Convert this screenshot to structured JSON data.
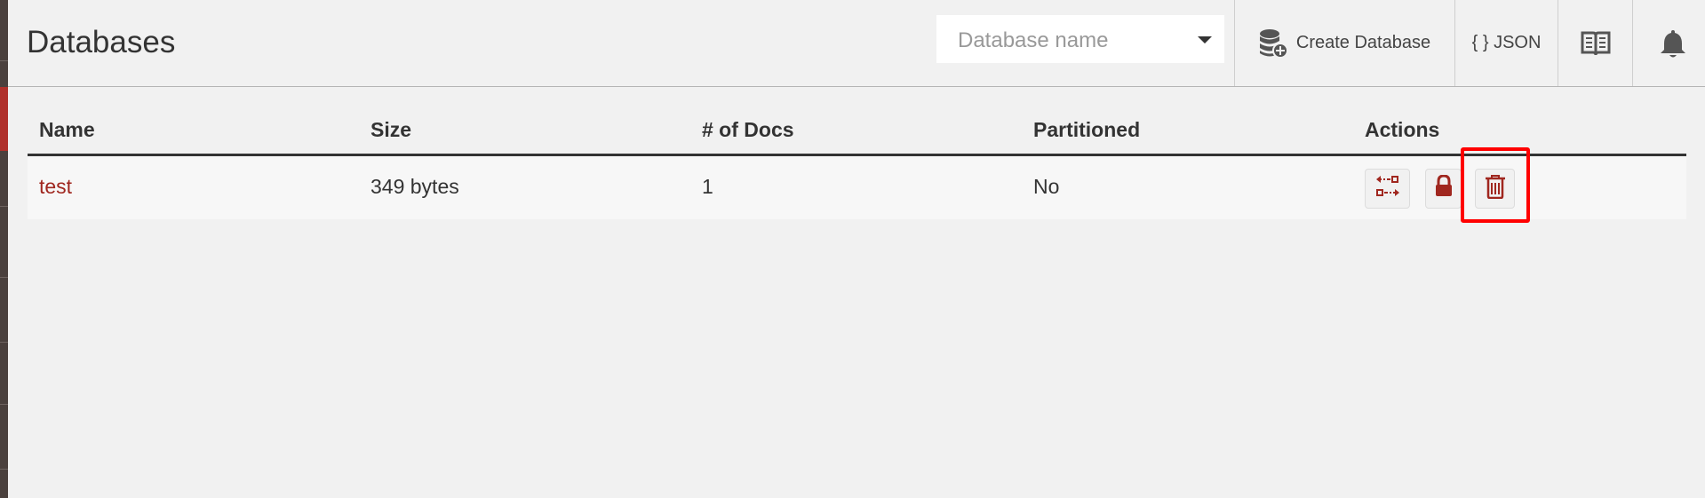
{
  "header": {
    "title": "Databases",
    "db_search_placeholder": "Database name",
    "create_label": "Create Database",
    "json_label": "{ } JSON"
  },
  "table": {
    "columns": [
      "Name",
      "Size",
      "# of Docs",
      "Partitioned",
      "Actions"
    ],
    "rows": [
      {
        "name": "test",
        "size": "349 bytes",
        "docs": "1",
        "partitioned": "No"
      }
    ]
  },
  "icons": {
    "create": "database-plus-icon",
    "docs": "book-icon",
    "notify": "bell-icon",
    "replicate": "replicate-icon",
    "permissions": "lock-icon",
    "delete": "trash-icon"
  },
  "colors": {
    "accent": "#a0271f",
    "highlight": "#ff0000",
    "sidebar": "#4a403d"
  }
}
